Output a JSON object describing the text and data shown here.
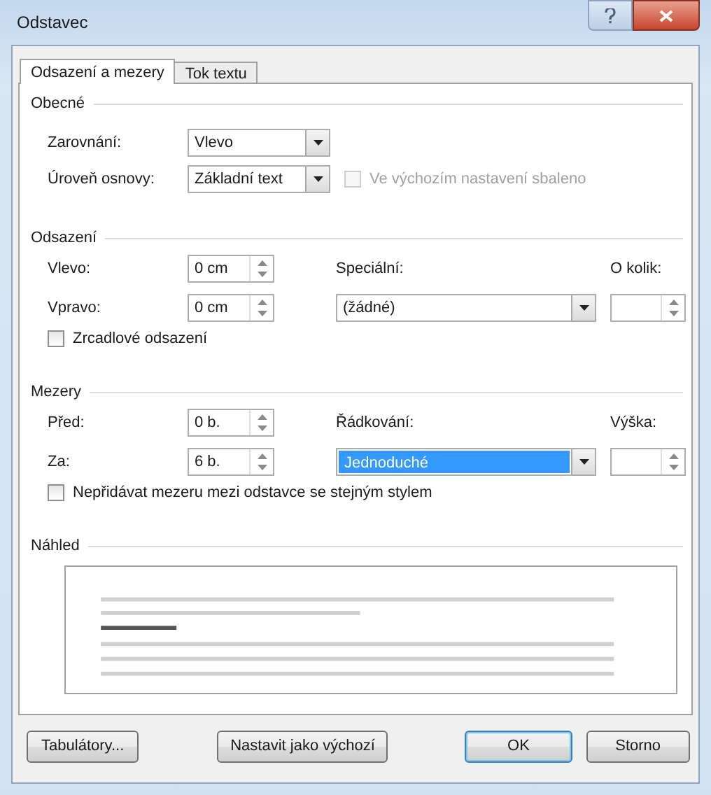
{
  "window": {
    "title": "Odstavec"
  },
  "tabs": [
    {
      "label": "Odsazení a mezery",
      "selected": true
    },
    {
      "label": "Tok textu",
      "selected": false
    }
  ],
  "general": {
    "heading": "Obecné",
    "alignment": {
      "label": "Zarovnání:",
      "value": "Vlevo",
      "focused": false
    },
    "outline_level": {
      "label": "Úroveň osnovy:",
      "value": "Základní text",
      "focused": false
    },
    "collapsed": {
      "label": "Ve výchozím nastavení sbaleno",
      "checked": false,
      "disabled": true
    }
  },
  "indentation": {
    "heading": "Odsazení",
    "left": {
      "label": "Vlevo:",
      "value": "0 cm"
    },
    "right": {
      "label": "Vpravo:",
      "value": "0 cm"
    },
    "special": {
      "label": "Speciální:",
      "value": "(žádné)",
      "focused": false
    },
    "by": {
      "label": "O kolik:"
    },
    "mirror": {
      "label": "Zrcadlové odsazení",
      "checked": false,
      "disabled": false
    }
  },
  "spacing": {
    "heading": "Mezery",
    "before": {
      "label": "Před:",
      "value": "0 b."
    },
    "after": {
      "label": "Za:",
      "value": "6 b."
    },
    "line_spacing": {
      "label": "Řádkování:",
      "value": "Jednoduché",
      "focused": true
    },
    "at": {
      "label": "Výška:"
    },
    "dont_add": {
      "label": "Nepřidávat mezeru mezi odstavce se stejným stylem",
      "checked": false,
      "disabled": false
    }
  },
  "preview": {
    "heading": "Náhled"
  },
  "buttons": [
    {
      "label": "Tabulátory...",
      "default": false
    },
    {
      "label": "Nastavit jako výchozí",
      "default": false
    },
    {
      "label": "OK",
      "default": true
    },
    {
      "label": "Storno",
      "default": false
    }
  ]
}
